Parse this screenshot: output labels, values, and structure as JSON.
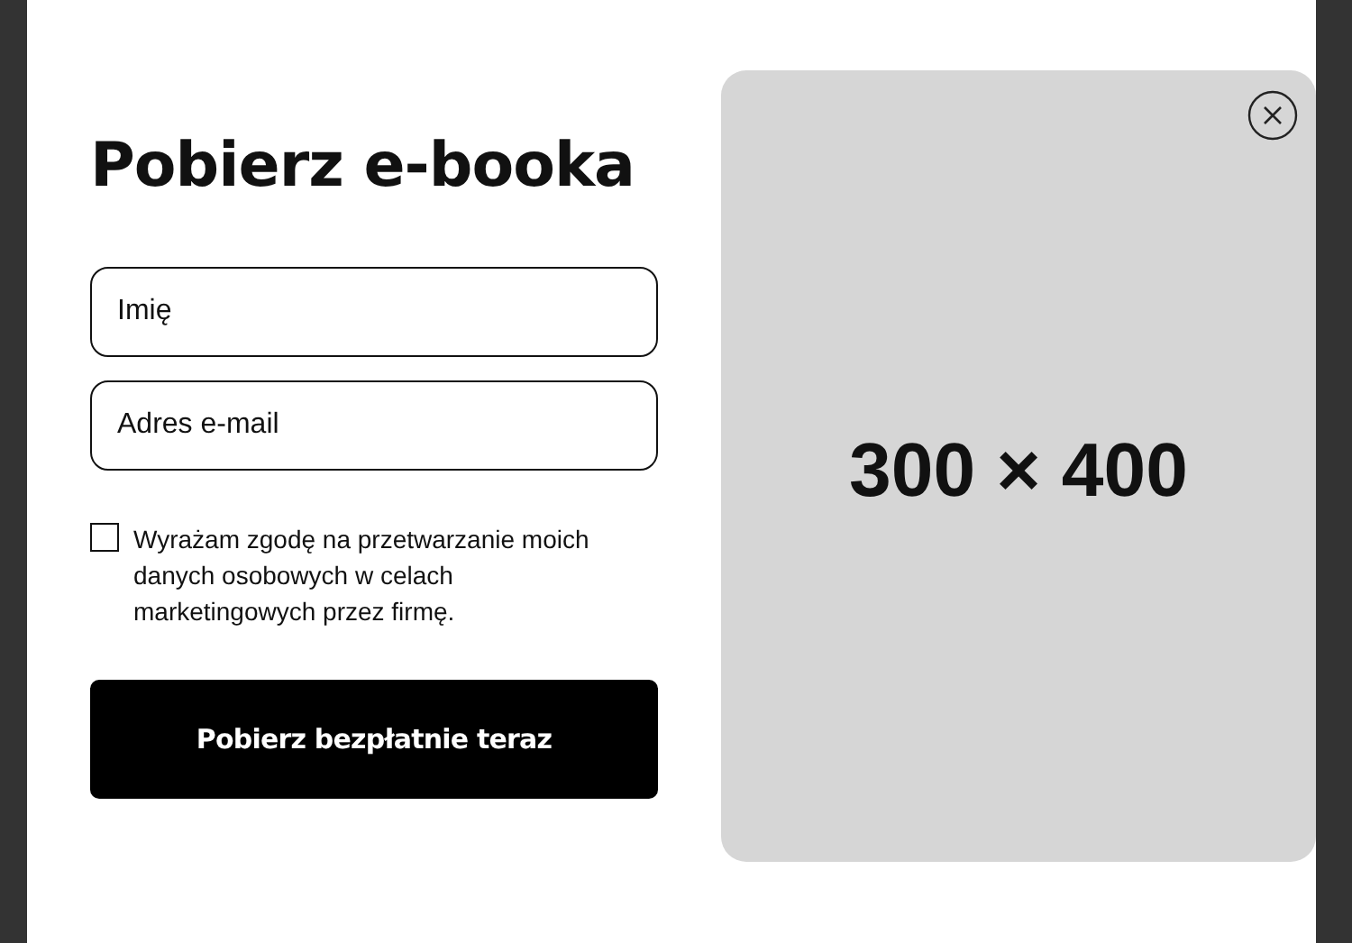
{
  "title": "Pobierz e-booka",
  "fields": [
    {
      "placeholder": "Imię"
    },
    {
      "placeholder": "Adres e-mail"
    }
  ],
  "consent": {
    "text": "Wyrażam zgodę na przetwarzanie moich danych osobowych w celach marketingowych przez firmę.",
    "checked": false
  },
  "submit_button": {
    "label": "Pobierz bezpłatnie teraz"
  },
  "image_placeholder": {
    "label": "300 × 400"
  }
}
